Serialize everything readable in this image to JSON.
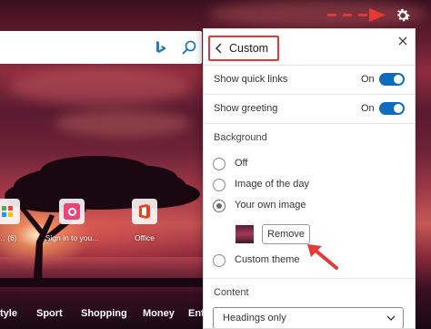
{
  "search": {
    "bing_icon": "bing-logo-icon",
    "search_icon": "search-icon"
  },
  "quick_links": [
    {
      "label": "… (6)",
      "icon": "app-icon"
    },
    {
      "label": "Sign in to you...",
      "icon": "office-o-icon",
      "color": "#e8457a"
    },
    {
      "label": "Office",
      "icon": "office-icon",
      "color": "#e2431e"
    }
  ],
  "bottom_nav": [
    "tyle",
    "Sport",
    "Shopping",
    "Money",
    "Ente"
  ],
  "panel": {
    "title": "Custom",
    "rows": [
      {
        "label": "Show quick links",
        "state": "On"
      },
      {
        "label": "Show greeting",
        "state": "On"
      }
    ],
    "background_title": "Background",
    "background_options": [
      {
        "label": "Off",
        "checked": false
      },
      {
        "label": "Image of the day",
        "checked": false
      },
      {
        "label": "Your own image",
        "checked": true
      },
      {
        "label": "Custom theme",
        "checked": false
      }
    ],
    "remove_label": "Remove",
    "content_title": "Content",
    "content_select": "Headings only"
  },
  "colors": {
    "accent": "#0f6cbd",
    "annotation_red": "#e53935"
  }
}
